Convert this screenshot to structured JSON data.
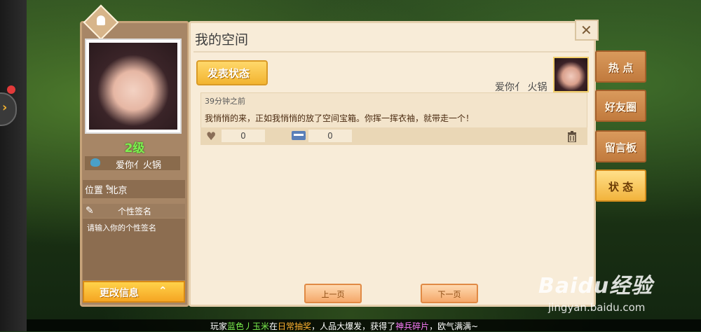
{
  "profile": {
    "level": "2级",
    "name": "爱你亻火锅",
    "location": "位置   :北京",
    "signature_label": "个性签名",
    "signature_placeholder": "请输入你的个性签名",
    "change_info": "更改信息"
  },
  "main": {
    "title": "我的空间",
    "post_button": "发表状态",
    "owner_name": "爱你亻 火锅",
    "feed": [
      {
        "time": "39分钟之前",
        "text": "我悄悄的来，正如我悄悄的放了空间宝箱。你挥一挥衣袖，就带走一个！",
        "likes": "0",
        "comments": "0"
      }
    ],
    "prev_page": "上一页",
    "next_page": "下一页"
  },
  "tabs": [
    {
      "label": "热 点",
      "active": false
    },
    {
      "label": "好友圈",
      "active": false
    },
    {
      "label": "留言板",
      "active": false
    },
    {
      "label": "状 态",
      "active": true
    }
  ],
  "marquee": {
    "prefix": "玩家",
    "player": "蓝色丿玉米",
    "mid1": "在",
    "event": "日常抽奖",
    "mid2": "，人品大爆发，获得了",
    "item": "神兵碎片",
    "suffix": "，欧气满满~"
  },
  "watermark": {
    "logo": "Baidu经验",
    "url": "jingyan.baidu.com"
  },
  "colors": {
    "level_green": "#7cf04e",
    "button_gold": "#f2b431",
    "tab_brown": "#c17a3d",
    "panel_cream": "#f8ecd8"
  }
}
